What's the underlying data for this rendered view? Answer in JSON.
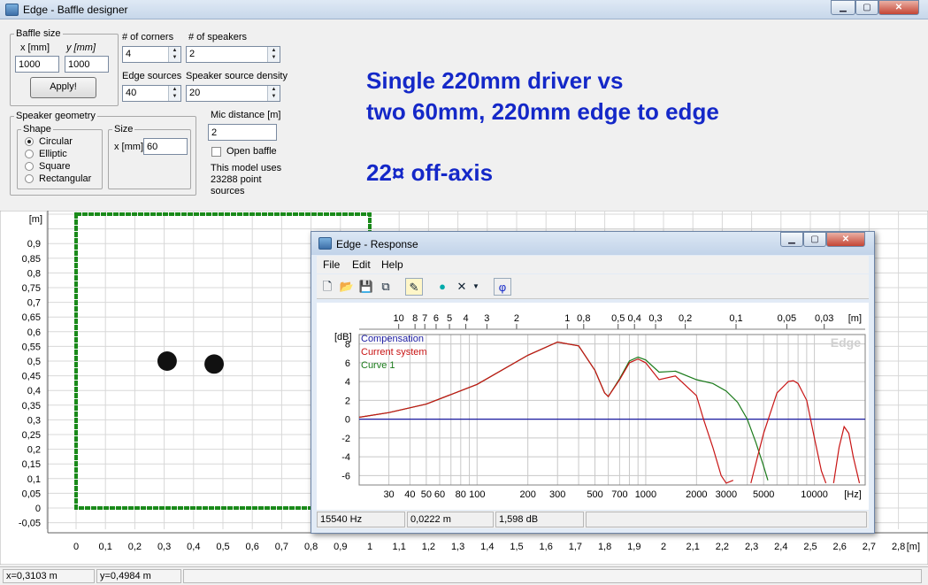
{
  "window": {
    "title": "Edge - Baffle designer"
  },
  "baffle": {
    "group": "Baffle size",
    "x_label": "x [mm]",
    "y_label": "y [mm]",
    "x_value": "1000",
    "y_value": "1000",
    "apply": "Apply!"
  },
  "corners": {
    "label": "# of corners",
    "value": "4"
  },
  "speakers": {
    "label": "# of speakers",
    "value": "2"
  },
  "edge_sources": {
    "label": "Edge sources",
    "value": "40"
  },
  "density": {
    "label": "Speaker source density",
    "value": "20"
  },
  "mic": {
    "label": "Mic distance [m]",
    "value": "2"
  },
  "open_baffle": {
    "label": "Open baffle",
    "checked": false
  },
  "model_note": [
    "This model uses",
    "23288 point",
    "sources"
  ],
  "geometry": {
    "group": "Speaker geometry",
    "shape_group": "Shape",
    "shapes": [
      "Circular",
      "Elliptic",
      "Square",
      "Rectangular"
    ],
    "selected": 0,
    "size_group": "Size",
    "size_label": "x [mm]",
    "size_value": "60"
  },
  "overlay": {
    "line1": "Single 220mm driver vs",
    "line2": "two 60mm, 220mm edge to edge",
    "line3": "22¤ off-axis"
  },
  "baffle_plot": {
    "unit_y": "[m]",
    "unit_x": "[m]",
    "y_ticks": [
      "0,9",
      "0,85",
      "0,8",
      "0,75",
      "0,7",
      "0,65",
      "0,6",
      "0,55",
      "0,5",
      "0,45",
      "0,4",
      "0,35",
      "0,3",
      "0,25",
      "0,2",
      "0,15",
      "0,1",
      "0,05",
      "0",
      "-0,05"
    ],
    "x_ticks": [
      "0",
      "0,1",
      "0,2",
      "0,3",
      "0,4",
      "0,5",
      "0,6",
      "0,7",
      "0,8",
      "0,9",
      "1",
      "1,1",
      "1,2",
      "1,3",
      "1,4",
      "1,5",
      "1,6",
      "1,7",
      "1,8",
      "1,9",
      "2",
      "2,1",
      "2,2",
      "2,3",
      "2,4",
      "2,5",
      "2,6",
      "2,7",
      "2,8"
    ],
    "baffle_rect": {
      "x": [
        0,
        1
      ],
      "y": [
        0,
        1
      ]
    },
    "drivers": [
      {
        "x": 0.31,
        "y": 0.5,
        "r": 0.03
      },
      {
        "x": 0.47,
        "y": 0.49,
        "r": 0.03
      }
    ],
    "colors": {
      "baffle": "#1a8a1a",
      "driver": "#111111",
      "grid": "#d8d8d8"
    }
  },
  "status": {
    "x": "x=0,3103 m",
    "y": "y=0,4984 m"
  },
  "response": {
    "title": "Edge - Response",
    "menu": [
      "File",
      "Edit",
      "Help"
    ],
    "tool_icons": [
      "new-icon",
      "open-icon",
      "save-icon",
      "copy-icon",
      "pen-icon",
      "mic-icon",
      "delete-icon",
      "dropdown-icon",
      "phase-icon"
    ],
    "phi": "φ",
    "status": [
      "15540 Hz",
      "0,0222 m",
      "1,598 dB"
    ],
    "watermark": "Edge",
    "chart_data": {
      "type": "line",
      "xlabel": "[Hz]",
      "ylabel": "[dB]",
      "top_axis_label": "[m]",
      "x_scale": "log",
      "xlim": [
        20,
        20000
      ],
      "ylim": [
        -7,
        9
      ],
      "x_ticks": [
        30,
        40,
        50,
        60,
        80,
        100,
        200,
        300,
        500,
        700,
        1000,
        2000,
        3000,
        5000,
        10000
      ],
      "y_ticks": [
        8,
        6,
        4,
        2,
        0,
        -2,
        -4,
        -6
      ],
      "top_ticks": [
        "10",
        "8",
        "7",
        "6",
        "5",
        "4",
        "3",
        "2",
        "1",
        "0,8",
        "0,5",
        "0,4",
        "0,3",
        "0,2",
        "0,1",
        "0,05",
        "0,03"
      ],
      "legend": [
        "Compensation",
        "Current system",
        "Curve 1"
      ],
      "series": [
        {
          "name": "Compensation",
          "color": "#1a1aa0",
          "x": [
            20,
            20000
          ],
          "y": [
            0,
            0
          ]
        },
        {
          "name": "Curve 1",
          "color": "#1a7a1a",
          "x": [
            20,
            30,
            50,
            100,
            200,
            300,
            400,
            500,
            570,
            600,
            700,
            800,
            900,
            1000,
            1200,
            1500,
            2000,
            2500,
            3000,
            3500,
            4000,
            4500,
            5000,
            5300
          ],
          "y": [
            0.2,
            0.7,
            1.6,
            3.7,
            6.8,
            8.2,
            7.8,
            5.2,
            2.8,
            2.4,
            4.3,
            6.2,
            6.6,
            6.3,
            5,
            5.1,
            4.2,
            3.8,
            3,
            1.8,
            0,
            -2.5,
            -5,
            -6.5
          ]
        },
        {
          "name": "Current system",
          "color": "#c81414",
          "x": [
            20,
            30,
            50,
            100,
            200,
            300,
            400,
            500,
            570,
            600,
            700,
            800,
            900,
            1000,
            1200,
            1500,
            2000,
            2200,
            2500,
            2800,
            3000,
            3300
          ],
          "y": [
            0.2,
            0.7,
            1.6,
            3.7,
            6.8,
            8.2,
            7.8,
            5.2,
            2.8,
            2.4,
            4.2,
            6,
            6.4,
            6,
            4.2,
            4.6,
            2.5,
            0,
            -3,
            -6,
            -6.8,
            -6.5
          ]
        },
        {
          "name": "Current system",
          "color": "#c81414",
          "x": [
            4200,
            4600,
            5000,
            6000,
            7000,
            7500,
            8000,
            9000,
            10000,
            11000,
            11700
          ],
          "y": [
            -6.8,
            -4,
            -1.5,
            2.8,
            4,
            4.1,
            3.8,
            2,
            -2,
            -5.5,
            -6.8
          ]
        },
        {
          "name": "Current system",
          "color": "#c81414",
          "x": [
            13000,
            14000,
            15000,
            16000,
            17000,
            18500
          ],
          "y": [
            -6.8,
            -3,
            -0.8,
            -1.5,
            -4,
            -6.8
          ]
        }
      ]
    }
  }
}
